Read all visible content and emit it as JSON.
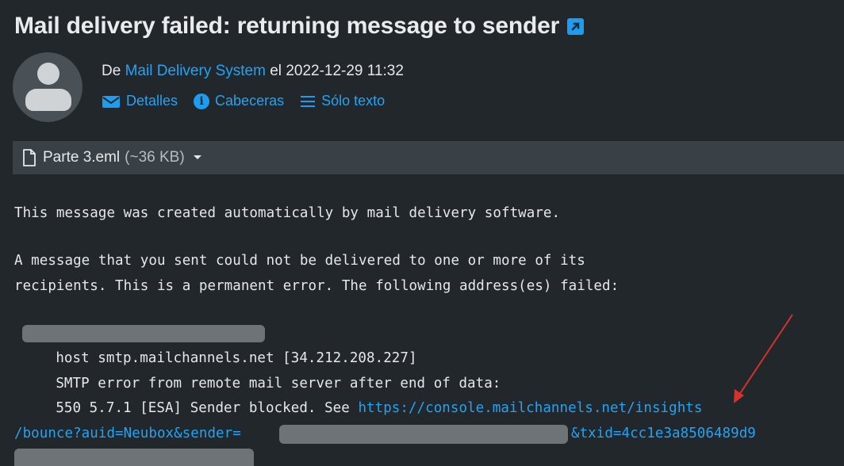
{
  "header": {
    "subject": "Mail delivery failed: returning message to sender",
    "from_prefix": "De",
    "from_name": "Mail Delivery System",
    "date_prefix": "el",
    "date": "2022-12-29 11:32"
  },
  "actions": [
    {
      "label": "Detalles",
      "icon": "envelope-icon"
    },
    {
      "label": "Cabeceras",
      "icon": "info-icon"
    },
    {
      "label": "Sólo texto",
      "icon": "lines-icon"
    }
  ],
  "attachment": {
    "name": "Parte 3.eml",
    "size": "(~36 KB)"
  },
  "body": {
    "line1": "This message was created automatically by mail delivery software.",
    "line2": "A message that you sent could not be delivered to one or more of its",
    "line3": "recipients. This is a permanent error. The following address(es) failed:",
    "host_line": "    host smtp.mailchannels.net [34.212.208.227]",
    "smtp_line": "    SMTP error from remote mail server after end of data:",
    "err_prefix": "    550 5.7.1 [ESA] Sender blocked. See ",
    "err_link": "https://console.mailchannels.net/insights",
    "link_cont1": "/bounce?auid=Neubox&sender=",
    "link_cont2": "&txid=4cc1e3a8506489d9"
  },
  "colors": {
    "background": "#22272b",
    "link": "#22a3f5",
    "annotation_arrow": "#d6322b"
  }
}
